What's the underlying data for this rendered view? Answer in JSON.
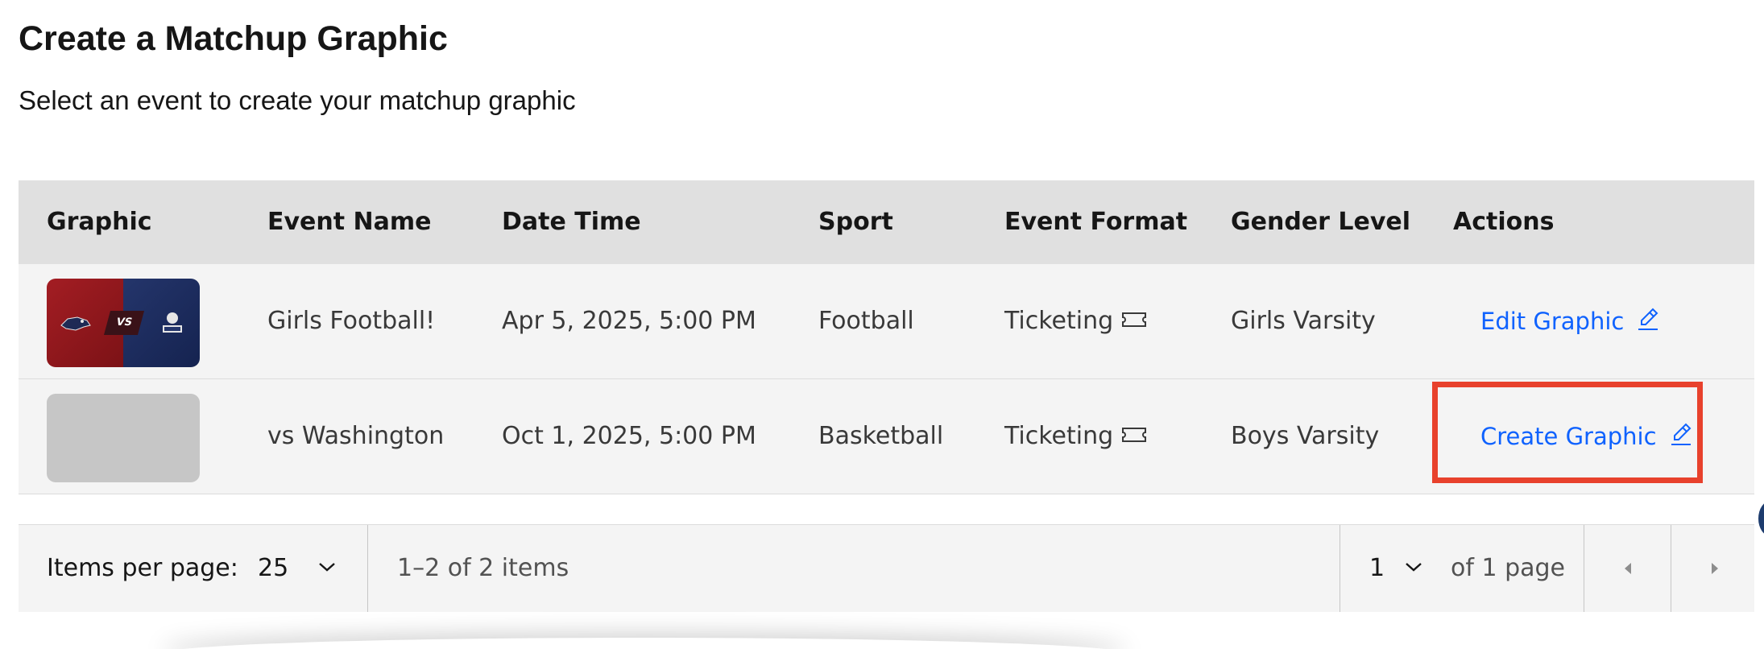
{
  "header": {
    "title": "Create a Matchup Graphic",
    "subtitle": "Select an event to create your matchup graphic"
  },
  "table": {
    "columns": [
      "Graphic",
      "Event Name",
      "Date Time",
      "Sport",
      "Event Format",
      "Gender Level",
      "Actions"
    ],
    "rows": [
      {
        "graphic": "matchup-thumbnail",
        "thumbnail_vs": "VS",
        "event_name": "Girls Football!",
        "date_time": "Apr 5, 2025, 5:00 PM",
        "sport": "Football",
        "event_format": "Ticketing",
        "gender_level": "Girls Varsity",
        "action_label": "Edit Graphic"
      },
      {
        "graphic": "empty-placeholder",
        "event_name": "vs Washington",
        "date_time": "Oct 1, 2025, 5:00 PM",
        "sport": "Basketball",
        "event_format": "Ticketing",
        "gender_level": "Boys Varsity",
        "action_label": "Create Graphic"
      }
    ]
  },
  "pagination": {
    "items_per_page_label": "Items per page:",
    "items_per_page_value": "25",
    "range_text": "1–2 of 2 items",
    "current_page": "1",
    "page_total_text": "of 1 page"
  },
  "colors": {
    "link": "#0f62fe",
    "highlight": "#e8412c",
    "header_bg": "#e0e0e0",
    "row_bg": "#f4f4f4"
  },
  "icons": [
    "ticket-icon",
    "pencil-icon",
    "chevron-down-icon",
    "caret-left-icon",
    "caret-right-icon"
  ]
}
